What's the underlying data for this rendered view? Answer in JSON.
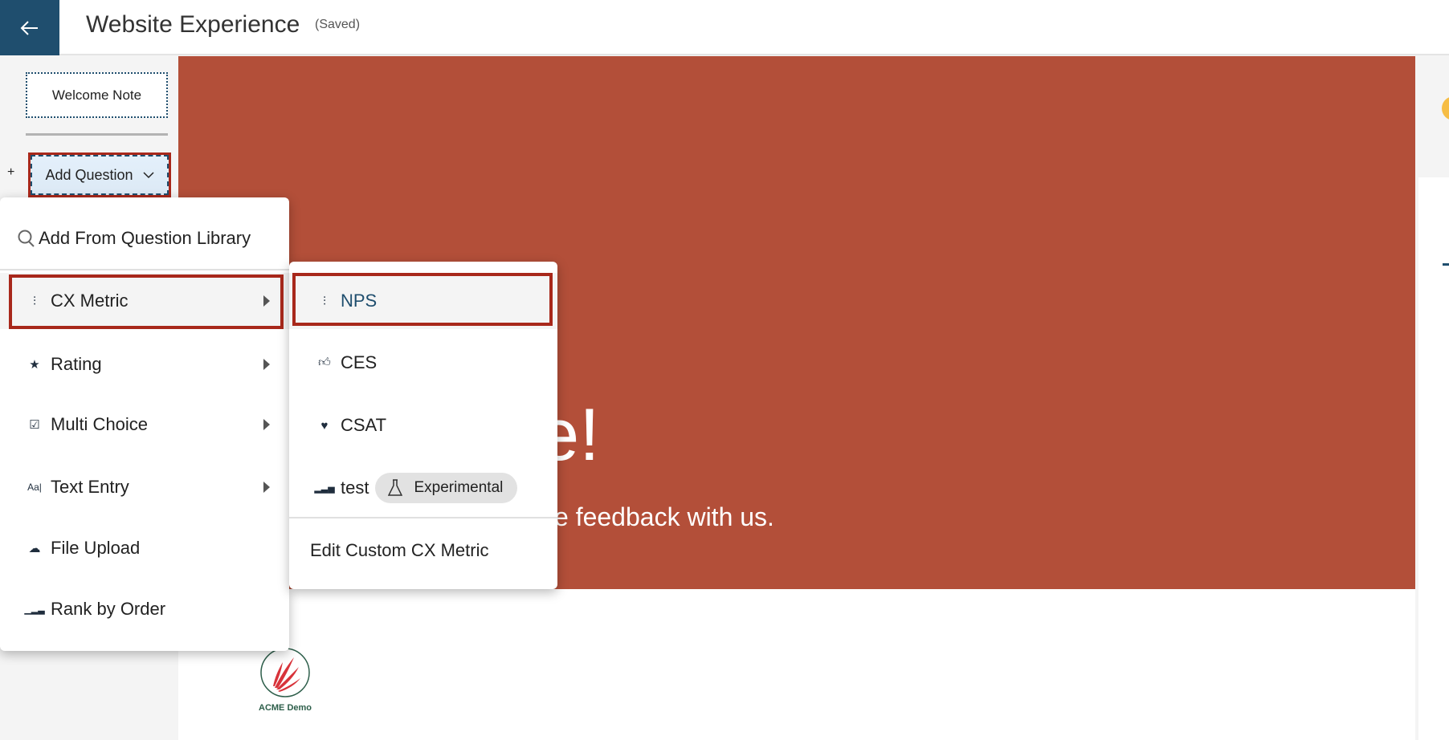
{
  "header": {
    "title": "Website Experience",
    "status": "(Saved)",
    "back_icon": "arrow-left-icon"
  },
  "sidebar": {
    "welcome_note": "Welcome Note",
    "add_prefix": "+",
    "add_question": "Add Question"
  },
  "banner": {
    "heading_fragment": "e!",
    "sub_fragment": "e feedback with us.",
    "color": "#b34f39"
  },
  "logo": {
    "text": "ACME Demo"
  },
  "menu": {
    "library": "Add From Question Library",
    "items": [
      {
        "label": "CX Metric",
        "icon": "nps-gauge-icon"
      },
      {
        "label": "Rating",
        "icon": "star-icon"
      },
      {
        "label": "Multi Choice",
        "icon": "checkbox-icon"
      },
      {
        "label": "Text Entry",
        "icon": "text-icon"
      },
      {
        "label": "File Upload",
        "icon": "cloud-upload-icon"
      },
      {
        "label": "Rank by Order",
        "icon": "bars-icon"
      }
    ]
  },
  "submenu": {
    "items": [
      {
        "label": "NPS",
        "icon": "nps-gauge-icon"
      },
      {
        "label": "CES",
        "icon": "thumbs-up-icon"
      },
      {
        "label": "CSAT",
        "icon": "heart-icon"
      },
      {
        "label": "test",
        "icon": "bars-icon",
        "badge": "Experimental"
      }
    ],
    "edit": "Edit Custom CX Metric"
  },
  "colors": {
    "accent": "#1f4e6e",
    "highlight": "#a8281b"
  }
}
